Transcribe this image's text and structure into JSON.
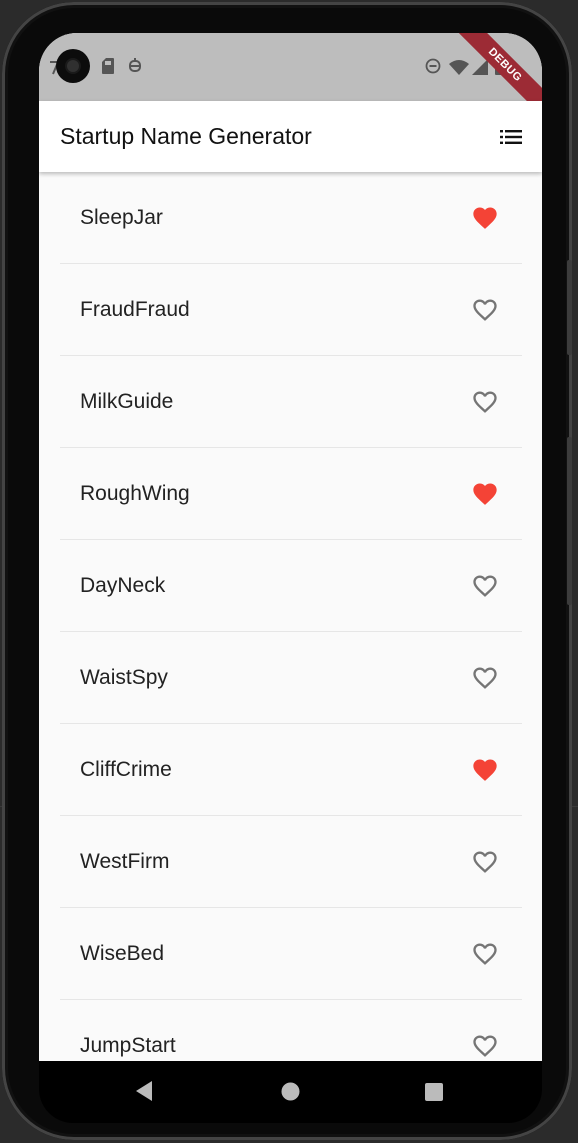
{
  "app_bar": {
    "title": "Startup Name Generator",
    "action_icon": "list-icon"
  },
  "debug_banner": "DEBUG",
  "colors": {
    "saved_heart": "#f44336",
    "unsaved_heart": "#757575",
    "app_bar_bg": "#ffffff",
    "status_bar_bg": "#bdbdbd",
    "debug_banner": "#9c2b35"
  },
  "suggestions": [
    {
      "name": "SleepJar",
      "saved": true
    },
    {
      "name": "FraudFraud",
      "saved": false
    },
    {
      "name": "MilkGuide",
      "saved": false
    },
    {
      "name": "RoughWing",
      "saved": true
    },
    {
      "name": "DayNeck",
      "saved": false
    },
    {
      "name": "WaistSpy",
      "saved": false
    },
    {
      "name": "CliffCrime",
      "saved": true
    },
    {
      "name": "WestFirm",
      "saved": false
    },
    {
      "name": "WiseBed",
      "saved": false
    },
    {
      "name": "JumpStart",
      "saved": false
    }
  ],
  "status_icons": [
    "camera-icon",
    "sim-card-icon",
    "notification-icon",
    "do-not-disturb-icon",
    "wifi-icon",
    "signal-icon",
    "battery-icon"
  ],
  "nav_icons": [
    "back-icon",
    "home-icon",
    "recents-icon"
  ]
}
